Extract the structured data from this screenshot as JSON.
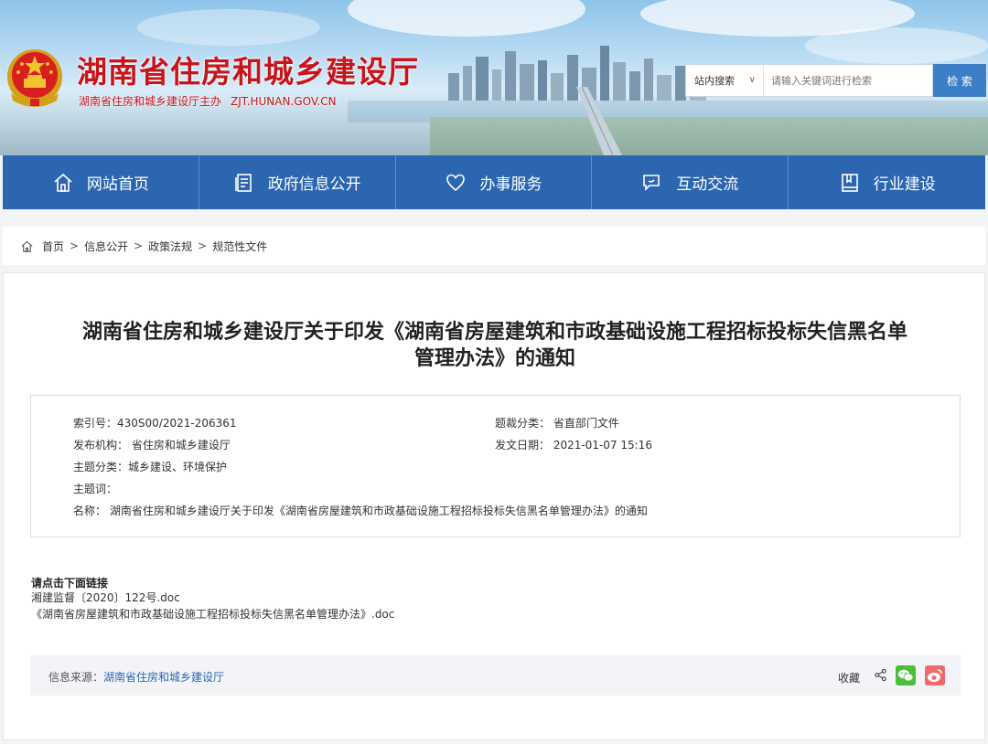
{
  "header": {
    "site_title": "湖南省住房和城乡建设厅",
    "site_sub": "湖南省住房和城乡建设厅主办",
    "domain": "ZJT.HUNAN.GOV.CN",
    "search_scope": "站内搜索",
    "search_placeholder": "请输入关键词进行检索",
    "search_button": "检 索"
  },
  "nav": {
    "items": [
      {
        "label": "网站首页",
        "icon": "home-icon"
      },
      {
        "label": "政府信息公开",
        "icon": "document-icon"
      },
      {
        "label": "办事服务",
        "icon": "heart-icon"
      },
      {
        "label": "互动交流",
        "icon": "chat-icon"
      },
      {
        "label": "行业建设",
        "icon": "book-icon"
      }
    ]
  },
  "breadcrumb": [
    "首页",
    "信息公开",
    "政策法规",
    "规范性文件"
  ],
  "article": {
    "title_line1": "湖南省住房和城乡建设厅关于印发《湖南省房屋建筑和市政基础设施工程招标投标失信黑名单",
    "title_line2": "管理办法》的通知",
    "meta": {
      "index": "索引号：430S00/2021-206361",
      "category": "题裁分类： 省直部门文件",
      "publisher": "发布机构： 省住房和城乡建设厅",
      "date": "发文日期： 2021-01-07 15:16",
      "subject": "主题分类：城乡建设、环境保护",
      "keywords": "主题词：",
      "name": "名称： 湖南省住房和城乡建设厅关于印发《湖南省房屋建筑和市政基础设施工程招标投标失信黑名单管理办法》的通知"
    },
    "links_head": "请点击下面链接",
    "links": [
      "湘建监督〔2020〕122号.doc",
      "《湖南省房屋建筑和市政基础设施工程招标投标失信黑名单管理办法》.doc"
    ],
    "source_label": "信息来源：",
    "source_value": "湖南省住房和城乡建设厅",
    "favorite": "收藏"
  }
}
